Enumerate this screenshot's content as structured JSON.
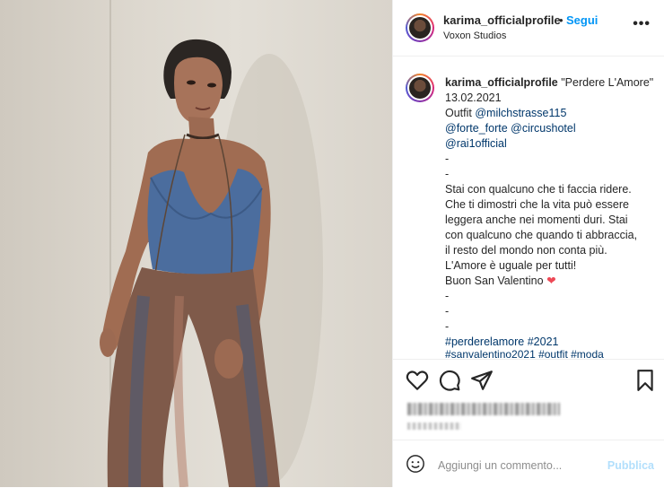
{
  "colors": {
    "follow": "#0095f6",
    "link": "#00376b",
    "heart": "#ed4956",
    "publish_disabled": "#b2dffc",
    "placeholder": "#8e8e8e"
  },
  "header": {
    "username": "karima_officialprofile",
    "separator": "•",
    "follow_label": "Segui",
    "location": "Voxon Studios",
    "more_icon": "more-options-icon",
    "more_label": "•••"
  },
  "caption": {
    "username": "karima_officialprofile",
    "title": "\"Perdere L'Amore\"",
    "date": "13.02.2021",
    "outfit_prefix": "Outfit ",
    "mentions": [
      "@milchstrasse115",
      "@forte_forte",
      "@circushotel",
      "@rai1official"
    ],
    "dash": "-",
    "body": [
      "Stai con qualcuno che ti faccia ridere.",
      "Che ti dimostri che la vita può essere",
      "leggera anche nei momenti duri. Stai",
      "con qualcuno che quando ti abbraccia,",
      "il resto del mondo non conta più.",
      "L'Amore è uguale per tutti!"
    ],
    "closing": "Buon San Valentino",
    "heart": "❤",
    "hashtags": "#perderelamore #2021",
    "hashtags_cut": "#sanvalentino2021 #outfit #moda"
  },
  "actions": {
    "icons": [
      "heart-icon",
      "comment-icon",
      "share-icon",
      "bookmark-icon"
    ]
  },
  "comment": {
    "placeholder": "Aggiungi un commento...",
    "publish_label": "Pubblica",
    "emoji_icon": "emoji-icon"
  }
}
